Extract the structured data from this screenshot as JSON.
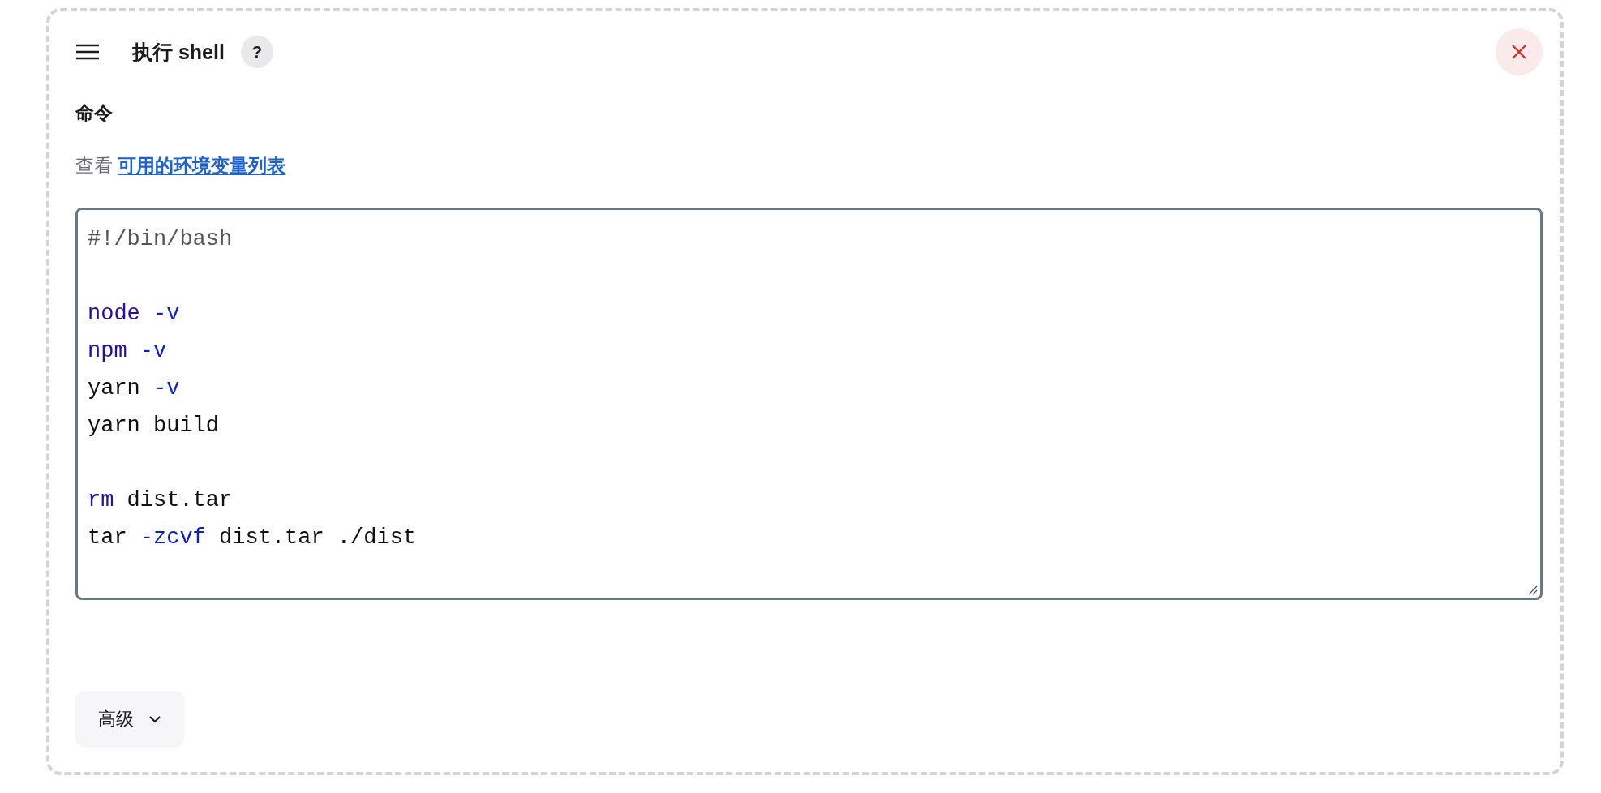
{
  "header": {
    "title": "执行 shell",
    "help": "?"
  },
  "field": {
    "label": "命令",
    "hint": {
      "prefix": "查看",
      "link": "可用的环境变量列表"
    }
  },
  "code": [
    {
      "kind": "text",
      "tokens": [
        {
          "kind": "comment",
          "text": "#!/bin/bash"
        }
      ]
    },
    {
      "kind": "blank"
    },
    {
      "kind": "text",
      "tokens": [
        {
          "kind": "keyword",
          "text": "node"
        },
        {
          "kind": "option",
          "text": " -v"
        }
      ]
    },
    {
      "kind": "text",
      "tokens": [
        {
          "kind": "keyword",
          "text": "npm"
        },
        {
          "kind": "option",
          "text": " -v"
        }
      ]
    },
    {
      "kind": "text",
      "tokens": [
        {
          "kind": "plain",
          "text": "yarn "
        },
        {
          "kind": "option",
          "text": "-v"
        }
      ]
    },
    {
      "kind": "text",
      "tokens": [
        {
          "kind": "plain",
          "text": "yarn build"
        }
      ]
    },
    {
      "kind": "blank"
    },
    {
      "kind": "text",
      "tokens": [
        {
          "kind": "keyword",
          "text": "rm"
        },
        {
          "kind": "plain",
          "text": " dist.tar"
        }
      ]
    },
    {
      "kind": "text",
      "tokens": [
        {
          "kind": "plain",
          "text": "tar "
        },
        {
          "kind": "option",
          "text": "-zcvf"
        },
        {
          "kind": "plain",
          "text": " dist.tar ./dist"
        }
      ]
    }
  ],
  "advanced": {
    "label": "高级",
    "expanded": false
  }
}
